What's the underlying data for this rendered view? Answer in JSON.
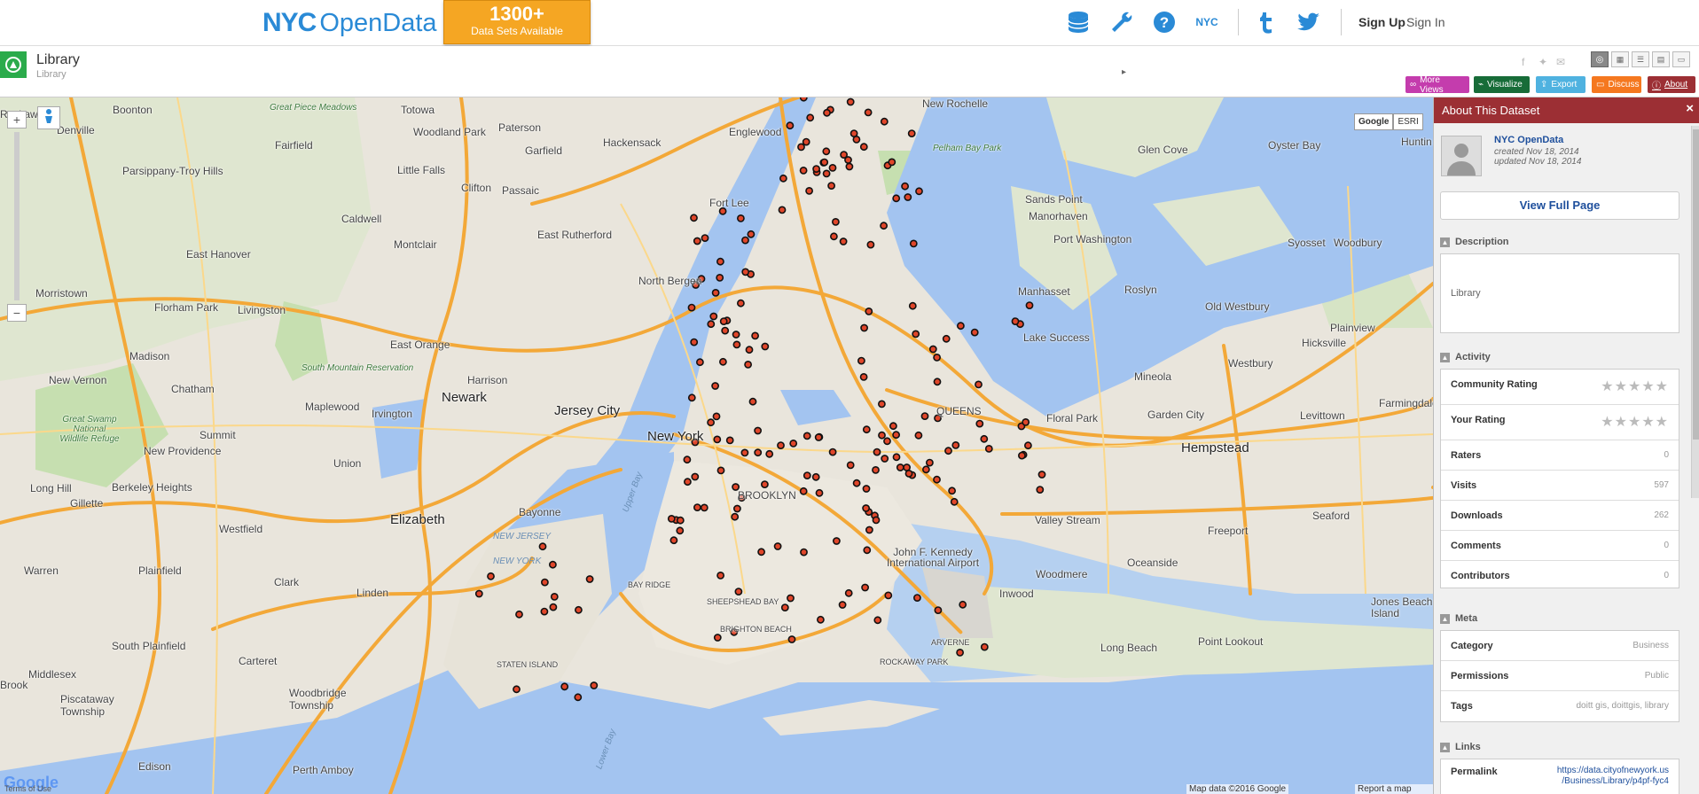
{
  "header": {
    "logo_nyc": "NYC",
    "logo_opendata": "OpenData",
    "banner_count": "1300+",
    "banner_text": "Data Sets Available",
    "nyc_icon_text": "NYC",
    "signup": "Sign Up",
    "signin": "Sign In"
  },
  "dataset": {
    "title": "Library",
    "subtitle": "Library"
  },
  "actions": {
    "more_views": "More Views",
    "visualize": "Visualize",
    "export": "Export",
    "discuss": "Discuss",
    "about": "About"
  },
  "colors": {
    "more_views": "#c43cad",
    "visualize": "#176c38",
    "export": "#4fb2e0",
    "discuss": "#f5781f",
    "about": "#9c2f34",
    "accent": "#2a8ad6",
    "point_fill": "#e0462a"
  },
  "map": {
    "maptype_google": "Google",
    "maptype_esri": "ESRI",
    "attribution": "Map data ©2016 Google",
    "report": "Report a map error",
    "terms": "Terms of Use",
    "google_logo": "Google",
    "labels": {
      "boonton": "Boonton",
      "totowa": "Totowa",
      "woodland_park": "Woodland Park",
      "paterson": "Paterson",
      "englewood": "Englewood",
      "new_rochelle": "New Rochelle",
      "great_piece": "Great Piece Meadows",
      "denville": "Denville",
      "fairfield": "Fairfield",
      "hackensack": "Hackensack",
      "parsippany": "Parsippany-Troy Hills",
      "little_falls": "Little Falls",
      "garfield": "Garfield",
      "pelham": "Pelham Bay Park",
      "glen_cove": "Glen Cove",
      "oyster_bay": "Oyster Bay",
      "clifton": "Clifton",
      "passaic": "Passaic",
      "fort_lee": "Fort Lee",
      "sands_point": "Sands Point",
      "manorhaven": "Manorhaven",
      "caldwell": "Caldwell",
      "east_rutherford": "East Rutherford",
      "port_washington": "Port Washington",
      "syosset": "Syosset",
      "woodbury": "Woodbury",
      "east_hanover": "East Hanover",
      "montclair": "Montclair",
      "north_bergen": "North Bergen",
      "manhasset": "Manhasset",
      "roslyn": "Roslyn",
      "old_westbury": "Old Westbury",
      "morristown": "Morristown",
      "florham_park": "Florham Park",
      "livingston": "Livingston",
      "lake_success": "Lake Success",
      "plainview": "Plainview",
      "hicksville": "Hicksville",
      "madison": "Madison",
      "east_orange": "East Orange",
      "south_mountain": "South Mountain Reservation",
      "mineola": "Mineola",
      "westbury": "Westbury",
      "new_vernon": "New Vernon",
      "chatham": "Chatham",
      "harrison": "Harrison",
      "newark": "Newark",
      "jersey_city": "Jersey City",
      "levittown": "Levittown",
      "farmingdale": "Farmingdale",
      "maplewood": "Maplewood",
      "irvington": "Irvington",
      "queens": "QUEENS",
      "floral_park": "Floral Park",
      "garden_city": "Garden City",
      "great_swamp": "Great Swamp National Wildlife Refuge",
      "summit": "Summit",
      "new_york": "New York",
      "hempstead": "Hempstead",
      "new_providence": "New Providence",
      "union": "Union",
      "long_hill": "Long Hill",
      "berkeley_heights": "Berkeley Heights",
      "gillette": "Gillette",
      "bayonne": "Bayonne",
      "brooklyn": "BROOKLYN",
      "valley_stream": "Valley Stream",
      "elizabeth": "Elizabeth",
      "seaford": "Seaford",
      "westfield": "Westfield",
      "freeport": "Freeport",
      "warren": "Warren",
      "plainfield": "Plainfield",
      "jfk": "John F. Kennedy International Airport",
      "oceanside": "Oceanside",
      "woodmere": "Woodmere",
      "clark": "Clark",
      "linden": "Linden",
      "inwood": "Inwood",
      "jones_beach": "Jones Beach Island",
      "long_beach": "Long Beach",
      "point_lookout": "Point Lookout",
      "south_plainfield": "South Plainfield",
      "middlesex": "Middlesex",
      "carteret": "Carteret",
      "woodbridge": "Woodbridge Township",
      "piscataway": "Piscataway Township",
      "perth_amboy": "Perth Amboy",
      "edison": "Edison",
      "upper_bay": "Upper Bay",
      "lower_bay": "Lower Bay",
      "new_jersey": "NEW JERSEY",
      "new_york_state": "NEW YORK",
      "staten_island": "STATEN ISLAND",
      "huntington": "Huntin",
      "brook": "Brook",
      "rockaway_label": "Rockaw",
      "sheepshead": "SHEEPSHEAD BAY",
      "bay_ridge": "BAY RIDGE",
      "brighton": "BRIGHTON BEACH",
      "arverne": "ARVERNE",
      "rockaway_park": "ROCKAWAY PARK"
    },
    "library_points_count": 205
  },
  "about_panel": {
    "title": "About This Dataset",
    "owner": "NYC OpenData",
    "created": "created Nov 18, 2014",
    "updated": "updated Nov 18, 2014",
    "view_full": "View Full Page",
    "description_head": "Description",
    "description": "Library",
    "activity_head": "Activity",
    "community_rating": "Community Rating",
    "your_rating": "Your Rating",
    "raters_label": "Raters",
    "raters": "0",
    "visits_label": "Visits",
    "visits": "597",
    "downloads_label": "Downloads",
    "downloads": "262",
    "comments_label": "Comments",
    "comments": "0",
    "contributors_label": "Contributors",
    "contributors": "0",
    "meta_head": "Meta",
    "category_label": "Category",
    "category": "Business",
    "permissions_label": "Permissions",
    "permissions": "Public",
    "tags_label": "Tags",
    "tags": "doitt gis, doittgis, library",
    "links_head": "Links",
    "permalink_label": "Permalink",
    "permalink_1": "https://data.cityofnewyork.us",
    "permalink_2": "/Business/Library/p4pf-fyc4"
  }
}
